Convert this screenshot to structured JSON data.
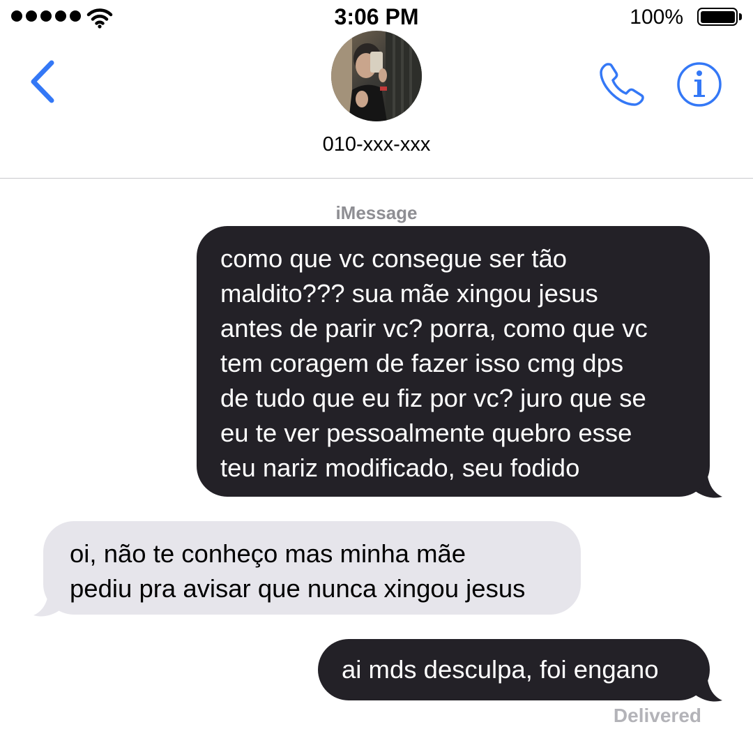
{
  "status_bar": {
    "time": "3:06 PM",
    "battery_percent": "100%",
    "signal_bars": 5,
    "icons": [
      "signal-dots-icon",
      "wifi-icon",
      "battery-icon"
    ]
  },
  "header": {
    "contact_name": "010-xxx-xxx",
    "icons": [
      "chevron-left-icon",
      "phone-icon",
      "info-icon"
    ],
    "accent_color": "#3478f6"
  },
  "conversation": {
    "service_label": "iMessage",
    "messages": [
      {
        "direction": "sent",
        "text": "como que vc consegue ser tão\nmaldito??? sua mãe xingou jesus\nantes de parir vc? porra, como que vc\ntem coragem de fazer isso cmg dps\nde tudo que eu fiz por vc? juro que se\neu te ver pessoalmente quebro esse\nteu nariz modificado, seu fodido"
      },
      {
        "direction": "received",
        "text": "oi, não te conheço mas minha mãe\npediu pra avisar que nunca xingou jesus"
      },
      {
        "direction": "sent",
        "text": "ai mds desculpa, foi engano"
      }
    ],
    "delivery_status": "Delivered",
    "sent_bubble_color": "#232127",
    "received_bubble_color": "#e6e5eb"
  }
}
